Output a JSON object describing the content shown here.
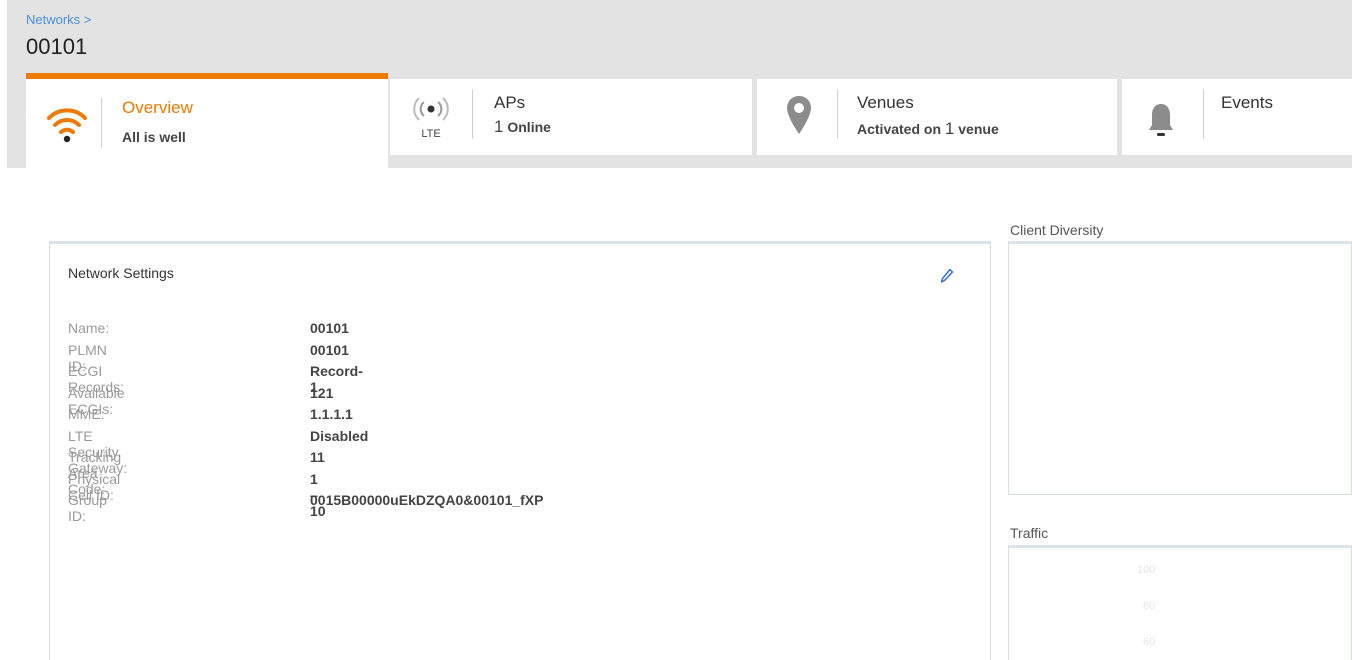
{
  "breadcrumb": "Networks >",
  "title": "00101",
  "tabs": {
    "overview": {
      "label": "Overview",
      "sub": "All is well",
      "icon": "wifi-icon",
      "color": "#f07a00"
    },
    "aps": {
      "label": "APs",
      "count": "1",
      "sub": "Online",
      "icon_caption": "LTE",
      "icon": "lte-antenna-icon"
    },
    "venues": {
      "label": "Venues",
      "sub_prefix": "Activated on",
      "count": "1",
      "sub_suffix": "venue",
      "icon": "map-pin-icon"
    },
    "events": {
      "label": "Events",
      "icon": "bell-icon"
    }
  },
  "network_settings": {
    "title": "Network Settings",
    "rows": [
      {
        "label": "Name:",
        "value": "00101"
      },
      {
        "label": "PLMN ID:",
        "value": "00101"
      },
      {
        "label": "ECGI Records:",
        "value": "Record-1"
      },
      {
        "label": "Available ECGIs:",
        "value": "121"
      },
      {
        "label": "MME:",
        "value": "1.1.1.1"
      },
      {
        "label": "LTE Security Gateway:",
        "value": "Disabled"
      },
      {
        "label": "Tracking Area Code:",
        "value": "11"
      },
      {
        "label": "Physical Cell ID:",
        "value": "1 – 10"
      },
      {
        "label": "Group ID:",
        "value": "0015B00000uEkDZQA0&00101_fXP"
      }
    ]
  },
  "client_diversity": {
    "title": "Client Diversity"
  },
  "traffic": {
    "title": "Traffic",
    "ticks": [
      "100",
      "80",
      "60"
    ]
  }
}
